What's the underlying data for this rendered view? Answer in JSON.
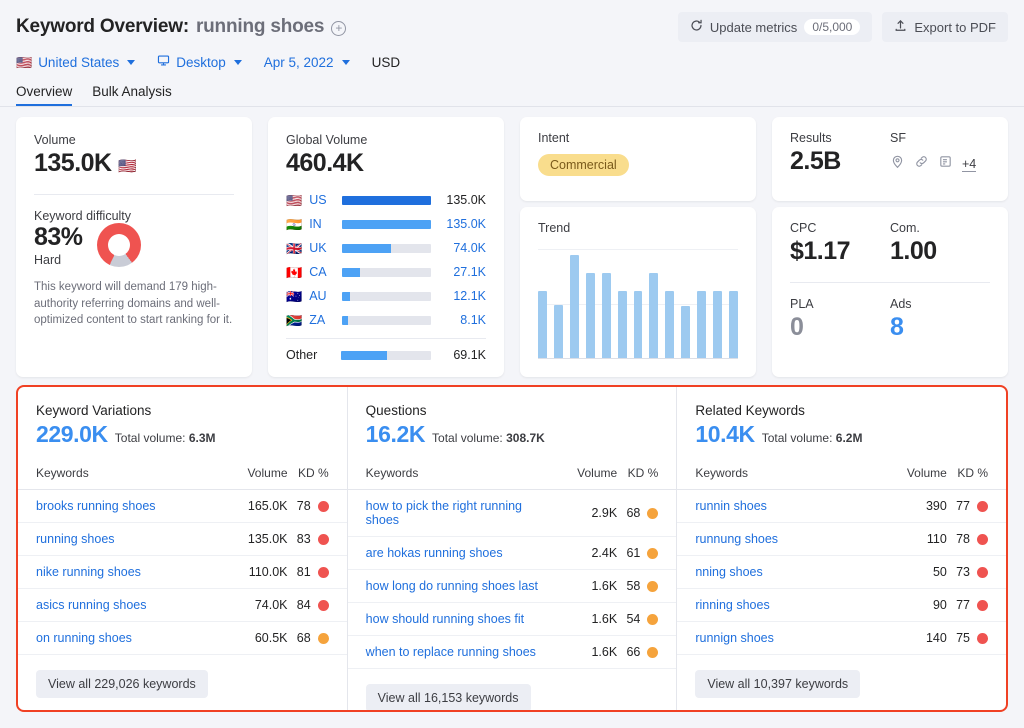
{
  "header": {
    "title_prefix": "Keyword Overview:",
    "keyword": "running shoes",
    "add_icon": "plus-circle-icon",
    "update_metrics_label": "Update metrics",
    "update_metrics_count": "0/5,000",
    "export_label": "Export to PDF"
  },
  "filters": {
    "country": "United States",
    "device": "Desktop",
    "date": "Apr 5, 2022",
    "currency": "USD"
  },
  "tabs": [
    {
      "label": "Overview",
      "active": true
    },
    {
      "label": "Bulk Analysis",
      "active": false
    }
  ],
  "volume_card": {
    "label": "Volume",
    "value": "135.0K",
    "flag": "us-flag-icon",
    "kd_label": "Keyword difficulty",
    "kd_value": "83%",
    "kd_percent": 83,
    "kd_level": "Hard",
    "kd_description": "This keyword will demand 179 high-authority referring domains and well-optimized content to start ranking for it."
  },
  "global_volume": {
    "label": "Global Volume",
    "value": "460.4K",
    "rows": [
      {
        "code": "US",
        "flag": "🇺🇸",
        "value": "135.0K",
        "pct": 100,
        "highlight": true
      },
      {
        "code": "IN",
        "flag": "🇮🇳",
        "value": "135.0K",
        "pct": 100,
        "highlight": false
      },
      {
        "code": "UK",
        "flag": "🇬🇧",
        "value": "74.0K",
        "pct": 55,
        "highlight": false
      },
      {
        "code": "CA",
        "flag": "🇨🇦",
        "value": "27.1K",
        "pct": 20,
        "highlight": false
      },
      {
        "code": "AU",
        "flag": "🇦🇺",
        "value": "12.1K",
        "pct": 9,
        "highlight": false
      },
      {
        "code": "ZA",
        "flag": "🇿🇦",
        "value": "8.1K",
        "pct": 6,
        "highlight": false
      }
    ],
    "other": {
      "code": "Other",
      "value": "69.1K",
      "pct": 51
    }
  },
  "intent_card": {
    "label": "Intent",
    "badge": "Commercial",
    "badge_bg": "#f9dd8d",
    "badge_fg": "#7a5a1b"
  },
  "results_card": {
    "results_label": "Results",
    "results_value": "2.5B",
    "sf_label": "SF",
    "sf_icons": [
      "map-pin-icon",
      "link-icon",
      "document-icon"
    ],
    "sf_more": "+4"
  },
  "trend_card": {
    "label": "Trend"
  },
  "cpc_card": {
    "cpc_label": "CPC",
    "cpc_value": "$1.17",
    "com_label": "Com.",
    "com_value": "1.00",
    "pla_label": "PLA",
    "pla_value": "0",
    "ads_label": "Ads",
    "ads_value": "8"
  },
  "chart_data": {
    "type": "bar",
    "title": "Trend",
    "xlabel": "",
    "ylabel": "",
    "grid": true,
    "legend": "none",
    "categories": [
      "1",
      "2",
      "3",
      "4",
      "5",
      "6",
      "7",
      "8",
      "9",
      "10",
      "11",
      "12",
      "13"
    ],
    "values": [
      62,
      49,
      95,
      78,
      78,
      62,
      62,
      78,
      62,
      48,
      62,
      62,
      62
    ],
    "ylim": [
      0,
      100
    ]
  },
  "panels": [
    {
      "title": "Keyword Variations",
      "kpi": "229.0K",
      "total_label": "Total volume:",
      "total_value": "6.3M",
      "columns": [
        "Keywords",
        "Volume",
        "KD %"
      ],
      "rows": [
        {
          "keyword": "brooks running shoes",
          "volume": "165.0K",
          "kd": "78",
          "dot": "#ef5350"
        },
        {
          "keyword": "running shoes",
          "volume": "135.0K",
          "kd": "83",
          "dot": "#ef5350"
        },
        {
          "keyword": "nike running shoes",
          "volume": "110.0K",
          "kd": "81",
          "dot": "#ef5350"
        },
        {
          "keyword": "asics running shoes",
          "volume": "74.0K",
          "kd": "84",
          "dot": "#ef5350"
        },
        {
          "keyword": "on running shoes",
          "volume": "60.5K",
          "kd": "68",
          "dot": "#f5a33c"
        }
      ],
      "view_all": "View all 229,026 keywords"
    },
    {
      "title": "Questions",
      "kpi": "16.2K",
      "total_label": "Total volume:",
      "total_value": "308.7K",
      "columns": [
        "Keywords",
        "Volume",
        "KD %"
      ],
      "rows": [
        {
          "keyword": "how to pick the right running shoes",
          "volume": "2.9K",
          "kd": "68",
          "dot": "#f5a33c"
        },
        {
          "keyword": "are hokas running shoes",
          "volume": "2.4K",
          "kd": "61",
          "dot": "#f5a33c"
        },
        {
          "keyword": "how long do running shoes last",
          "volume": "1.6K",
          "kd": "58",
          "dot": "#f5a33c"
        },
        {
          "keyword": "how should running shoes fit",
          "volume": "1.6K",
          "kd": "54",
          "dot": "#f5a33c"
        },
        {
          "keyword": "when to replace running shoes",
          "volume": "1.6K",
          "kd": "66",
          "dot": "#f5a33c"
        }
      ],
      "view_all": "View all 16,153 keywords"
    },
    {
      "title": "Related Keywords",
      "kpi": "10.4K",
      "total_label": "Total volume:",
      "total_value": "6.2M",
      "columns": [
        "Keywords",
        "Volume",
        "KD %"
      ],
      "rows": [
        {
          "keyword": "runnin shoes",
          "volume": "390",
          "kd": "77",
          "dot": "#ef5350"
        },
        {
          "keyword": "runnung shoes",
          "volume": "110",
          "kd": "78",
          "dot": "#ef5350"
        },
        {
          "keyword": "nning shoes",
          "volume": "50",
          "kd": "73",
          "dot": "#ef5350"
        },
        {
          "keyword": "rinning shoes",
          "volume": "90",
          "kd": "77",
          "dot": "#ef5350"
        },
        {
          "keyword": "runnign shoes",
          "volume": "140",
          "kd": "75",
          "dot": "#ef5350"
        }
      ],
      "view_all": "View all 10,397 keywords"
    }
  ]
}
